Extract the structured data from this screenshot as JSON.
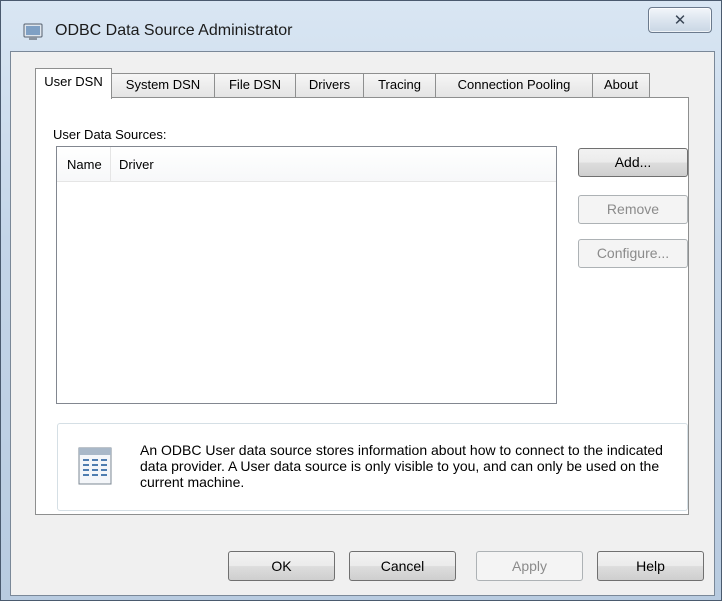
{
  "window": {
    "title": "ODBC Data Source Administrator",
    "close_glyph": "✕"
  },
  "tabs": [
    {
      "label": "User DSN",
      "active": true
    },
    {
      "label": "System DSN",
      "active": false
    },
    {
      "label": "File DSN",
      "active": false
    },
    {
      "label": "Drivers",
      "active": false
    },
    {
      "label": "Tracing",
      "active": false
    },
    {
      "label": "Connection Pooling",
      "active": false
    },
    {
      "label": "About",
      "active": false
    }
  ],
  "user_dsn": {
    "group_label": "User Data Sources:",
    "columns": [
      "Name",
      "Driver"
    ],
    "rows": [],
    "buttons": {
      "add": "Add...",
      "remove": "Remove",
      "configure": "Configure..."
    },
    "info_text": "An ODBC User data source stores information about how to connect to the indicated data provider.   A User data source is only visible to you, and can only be used on the current machine."
  },
  "footer": {
    "ok": "OK",
    "cancel": "Cancel",
    "apply": "Apply",
    "help": "Help"
  }
}
